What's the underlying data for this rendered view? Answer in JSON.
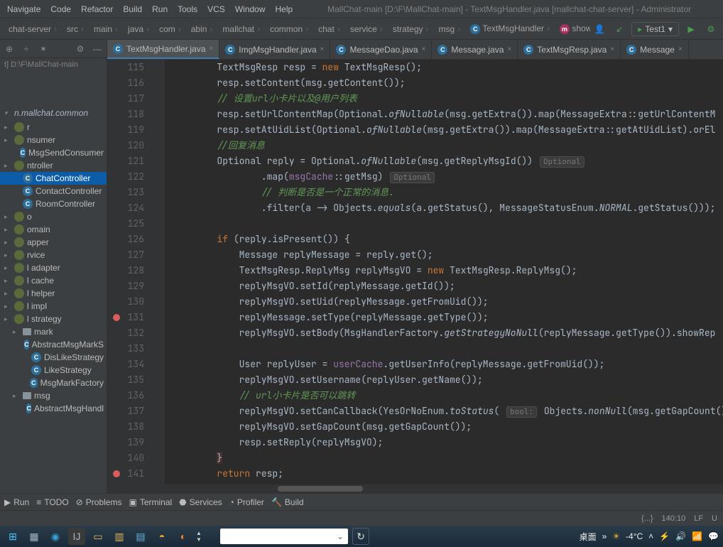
{
  "window": {
    "title": "MallChat-main [D:\\F\\MallChat-main] - TextMsgHandler.java [mallchat-chat-server] - Administrator"
  },
  "menu": {
    "navigate": "Navigate",
    "code": "Code",
    "refactor": "Refactor",
    "build": "Build",
    "run": "Run",
    "tools": "Tools",
    "vcs": "VCS",
    "window": "Window",
    "help": "Help"
  },
  "breadcrumbs": [
    "chat-server",
    "src",
    "main",
    "java",
    "com",
    "abin",
    "mallchat",
    "common",
    "chat",
    "service",
    "strategy",
    "msg",
    "TextMsgHandler",
    "showMsg"
  ],
  "run_config": "Test1",
  "project": {
    "path": "t]  D:\\F\\MallChat-main",
    "root_pkg": "n.mallchat.common",
    "items": [
      {
        "label": "r",
        "type": "pkg"
      },
      {
        "label": "nsumer",
        "type": "pkg"
      },
      {
        "label": "MsgSendConsumer",
        "type": "cls",
        "indent": 1
      },
      {
        "label": "ntroller",
        "type": "pkg"
      },
      {
        "label": "ChatController",
        "type": "cls",
        "indent": 1,
        "selected": true
      },
      {
        "label": "ContactController",
        "type": "cls",
        "indent": 1
      },
      {
        "label": "RoomController",
        "type": "cls",
        "indent": 1
      },
      {
        "label": "o",
        "type": "pkg"
      },
      {
        "label": "omain",
        "type": "pkg"
      },
      {
        "label": "apper",
        "type": "pkg"
      },
      {
        "label": "rvice",
        "type": "pkg"
      },
      {
        "label": "l adapter",
        "type": "pkg"
      },
      {
        "label": "l cache",
        "type": "pkg"
      },
      {
        "label": "l helper",
        "type": "pkg"
      },
      {
        "label": "l impl",
        "type": "pkg"
      },
      {
        "label": "l strategy",
        "type": "pkg"
      },
      {
        "label": "mark",
        "type": "fold",
        "indent": 1
      },
      {
        "label": "AbstractMsgMarkS",
        "type": "cls",
        "indent": 2
      },
      {
        "label": "DisLikeStrategy",
        "type": "cls",
        "indent": 2
      },
      {
        "label": "LikeStrategy",
        "type": "cls",
        "indent": 2
      },
      {
        "label": "MsgMarkFactory",
        "type": "cls",
        "indent": 2
      },
      {
        "label": "msg",
        "type": "fold",
        "indent": 1
      },
      {
        "label": "AbstractMsgHandl",
        "type": "cls",
        "indent": 2
      }
    ]
  },
  "tabs": [
    {
      "label": "TextMsgHandler.java",
      "icon": "c",
      "active": true
    },
    {
      "label": "ImgMsgHandler.java",
      "icon": "c"
    },
    {
      "label": "MessageDao.java",
      "icon": "c"
    },
    {
      "label": "Message.java",
      "icon": "c"
    },
    {
      "label": "TextMsgResp.java",
      "icon": "c"
    },
    {
      "label": "Message",
      "icon": "c"
    }
  ],
  "gutter": {
    "start": 115,
    "end": 141,
    "breakpoints": [
      131,
      141
    ]
  },
  "code": {
    "l115": "TextMsgResp resp = new TextMsgResp();",
    "l116": "resp.setContent(msg.getContent());",
    "l117": "// 设置url小卡片以及@用户列表",
    "l118": "resp.setUrlContentMap(Optional.ofNullable(msg.getExtra()).map(MessageExtra::getUrlContentM",
    "l119": "resp.setAtUidList(Optional.ofNullable(msg.getExtra()).map(MessageExtra::getAtUidList).orEl",
    "l120": "//回复消息",
    "l121a": "Optional<Message> reply = Optional.ofNullable(msg.getReplyMsgId())",
    "l121h": "Optional<Long>",
    "l122a": "        .map(msgCache::getMsg)",
    "l122h": "Optional<Message>",
    "l123": "        // 判断是否是一个正常的消息.",
    "l124": "        .filter(a -> Objects.equals(a.getStatus(), MessageStatusEnum.NORMAL.getStatus()));",
    "l126": "if (reply.isPresent()) {",
    "l127": "    Message replyMessage = reply.get();",
    "l128": "    TextMsgResp.ReplyMsg replyMsgVO = new TextMsgResp.ReplyMsg();",
    "l129": "    replyMsgVO.setId(replyMessage.getId());",
    "l130": "    replyMsgVO.setUid(replyMessage.getFromUid());",
    "l131": "    replyMessage.setType(replyMessage.getType());",
    "l132": "    replyMsgVO.setBody(MsgHandlerFactory.getStrategyNoNull(replyMessage.getType()).showRep",
    "l134": "    User replyUser = userCache.getUserInfo(replyMessage.getFromUid());",
    "l135": "    replyMsgVO.setUsername(replyUser.getName());",
    "l136": "    // url小卡片是否可以跳转",
    "l137a": "    replyMsgVO.setCanCallback(YesOrNoEnum.toStatus(",
    "l137h": "bool:",
    "l137b": " Objects.nonNull(msg.getGapCount()",
    "l138": "    replyMsgVO.setGapCount(msg.getGapCount());",
    "l139": "    resp.setReply(replyMsgVO);",
    "l140": "}",
    "l141": "return resp;"
  },
  "bottom_tools": {
    "run": "Run",
    "todo": "TODO",
    "problems": "Problems",
    "terminal": "Terminal",
    "services": "Services",
    "profiler": "Profiler",
    "build": "Build"
  },
  "status": {
    "braces": "{...}",
    "pos": "140:10",
    "lf": "LF",
    "enc": "U"
  },
  "taskbar": {
    "desktop": "桌面",
    "temp": "-4°C"
  }
}
